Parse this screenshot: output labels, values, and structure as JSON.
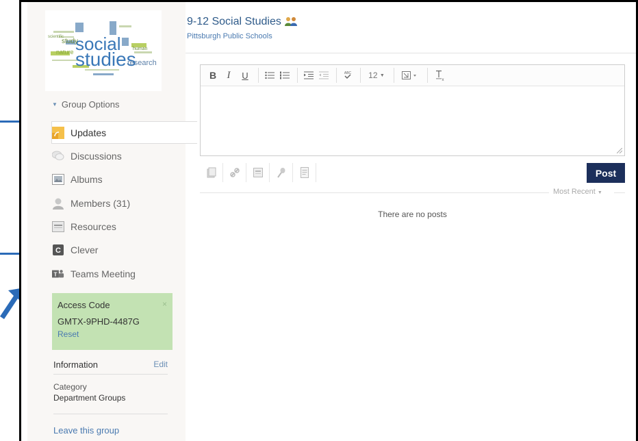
{
  "group": {
    "title": "9-12 Social Studies",
    "school": "Pittsburgh Public Schools"
  },
  "logo": {
    "words": [
      "social",
      "studies",
      "study",
      "nature",
      "human",
      "research",
      "scientific"
    ]
  },
  "sidebar": {
    "group_options": "Group Options",
    "items": [
      {
        "label": "Updates",
        "icon": "updates-icon"
      },
      {
        "label": "Discussions",
        "icon": "discussions-icon"
      },
      {
        "label": "Albums",
        "icon": "albums-icon"
      },
      {
        "label": "Members (31)",
        "icon": "members-icon"
      },
      {
        "label": "Resources",
        "icon": "resources-icon"
      },
      {
        "label": "Clever",
        "icon": "clever-icon"
      },
      {
        "label": "Teams Meeting",
        "icon": "teams-icon"
      }
    ],
    "access": {
      "title": "Access Code",
      "code": "GMTX-9PHD-4487G",
      "reset": "Reset",
      "close": "×"
    },
    "information": {
      "title": "Information",
      "edit": "Edit",
      "category_label": "Category",
      "category_value": "Department Groups"
    },
    "leave": "Leave this group"
  },
  "editor": {
    "font_size": "12",
    "post_label": "Post"
  },
  "feed": {
    "sort_label": "Most Recent",
    "empty": "There are no posts"
  },
  "colors": {
    "accent": "#1c2f5b",
    "link": "#4a7ab0",
    "access_bg": "#c3e2b3",
    "annotation": "#2b6bb8"
  }
}
